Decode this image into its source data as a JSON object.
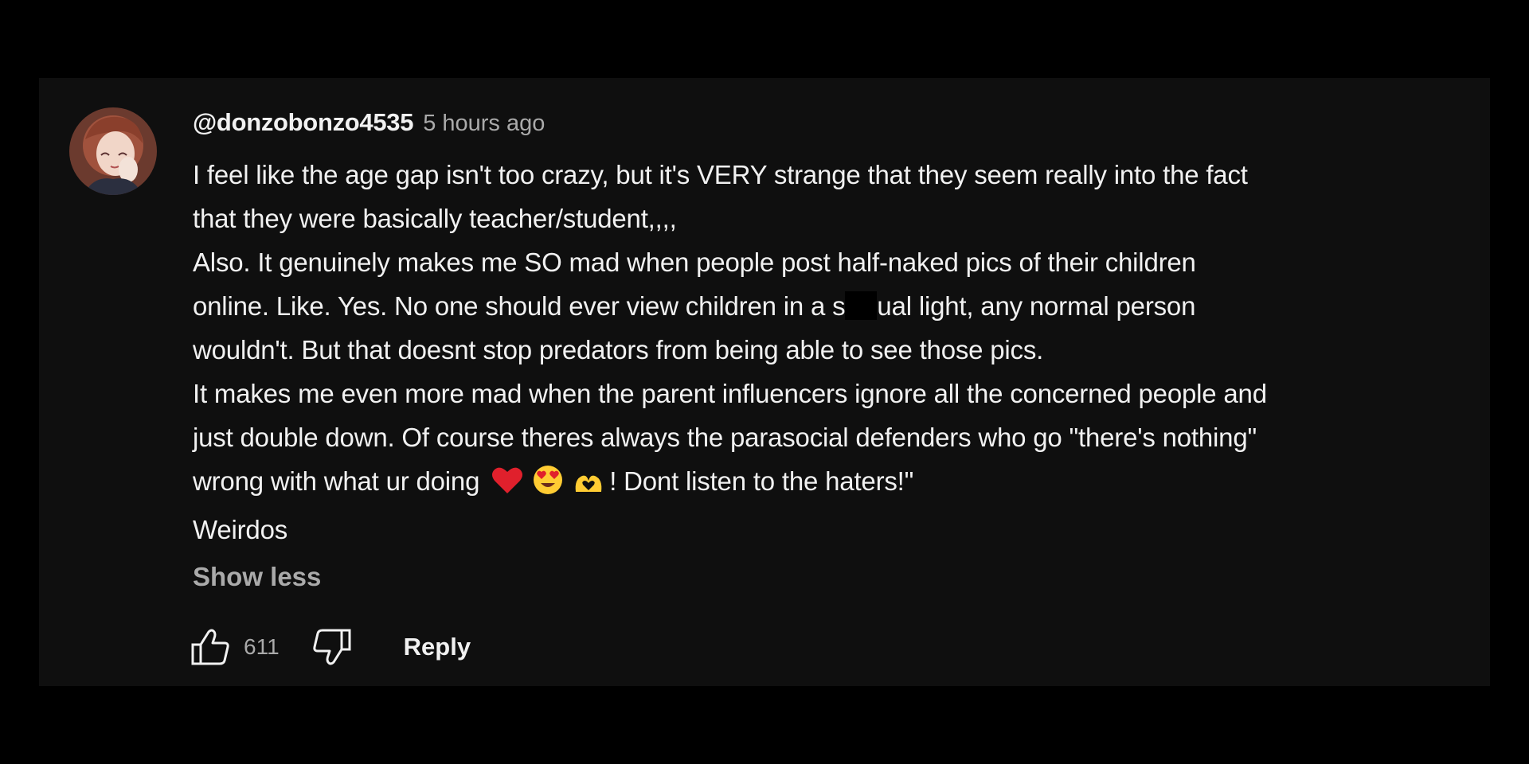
{
  "comment": {
    "author": "@donzobonzo4535",
    "time": "5 hours ago",
    "lines": [
      "I feel like the age gap isn't too crazy, but it's VERY strange that they seem really into the fact",
      "that they were basically teacher/student,,,,",
      "Also. It genuinely makes me SO mad when people post half-naked pics of their children",
      "wouldn't. But that doesnt stop predators from being able to see those pics.",
      "It makes me even more mad when the parent influencers ignore all the concerned people and",
      "just double down. Of course theres always the parasocial defenders who go \"there's nothing\""
    ],
    "line5_before": "online. Like. Yes. No one should ever view children in a s",
    "line5_after": "ual light, any normal person",
    "line8_before": "wrong with what ur doing",
    "line8_after": "! Dont listen to the haters!\"",
    "last_line": "Weirdos",
    "show_less": "Show less",
    "like_count": "611",
    "reply_label": "Reply"
  },
  "icons": [
    "avatar",
    "heart-emoji",
    "heart-eyes-emoji",
    "heart-hands-emoji",
    "thumbs-up-icon",
    "thumbs-down-icon"
  ],
  "colors": {
    "background": "#0f0f0f",
    "text": "#f1f1f1",
    "secondary": "#aaaaaa"
  }
}
